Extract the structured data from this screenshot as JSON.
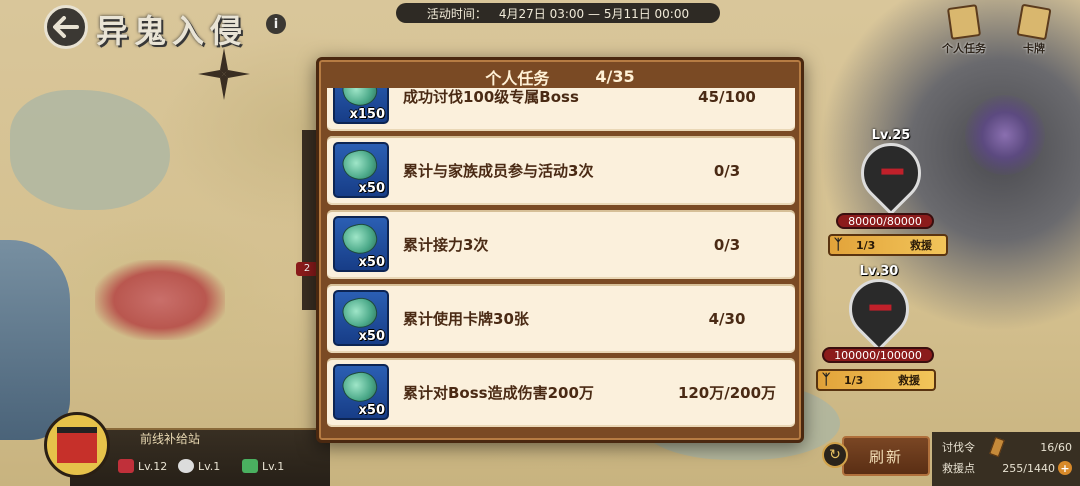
{
  "header": {
    "title": "异鬼入侵",
    "event_time_label": "活动时间：",
    "event_time_value": "4月27日 03:00 — 5月11日 00:00"
  },
  "top_right": {
    "personal_tasks_label": "个人任务",
    "cards_label": "卡牌"
  },
  "bosses": [
    {
      "level": "Lv.25",
      "hp": "80000/80000",
      "progress": "1/3",
      "action": "救援"
    },
    {
      "level": "Lv.30",
      "hp": "100000/100000",
      "progress": "1/3",
      "action": "救援"
    }
  ],
  "map_badge": "2",
  "station": {
    "name": "前线补给站",
    "stats": [
      "Lv.12",
      "Lv.1",
      "Lv.1"
    ]
  },
  "bottom_right": {
    "refresh_label": "刷新",
    "token_label": "讨伐令",
    "token_value": "16/60",
    "rescue_points_label": "救援点",
    "rescue_points_value": "255/1440"
  },
  "modal": {
    "title": "个人任务",
    "progress": "4/35",
    "tasks": [
      {
        "name": "成功讨伐100级专属Boss",
        "progress": "45/100",
        "reward_qty": "x150"
      },
      {
        "name": "累计与家族成员参与活动3次",
        "progress": "0/3",
        "reward_qty": "x50"
      },
      {
        "name": "累计接力3次",
        "progress": "0/3",
        "reward_qty": "x50"
      },
      {
        "name": "累计使用卡牌30张",
        "progress": "4/30",
        "reward_qty": "x50"
      },
      {
        "name": "累计对Boss造成伤害200万",
        "progress": "120万/200万",
        "reward_qty": "x50"
      }
    ]
  },
  "colors": {
    "modal_frame": "#7a4a24",
    "row_bg": "#fbf0dc",
    "row_text": "#4a2a14",
    "hp_bar": "#8b1b1b",
    "rescue_button": "#f2c55a"
  }
}
